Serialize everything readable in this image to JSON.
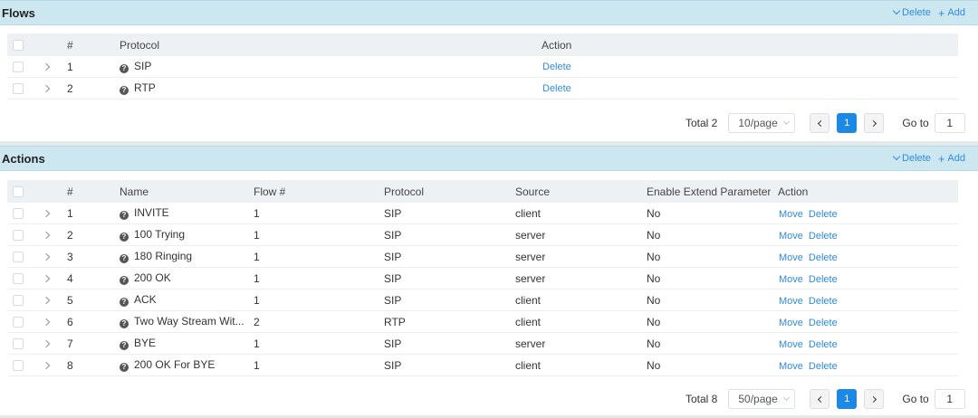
{
  "flows": {
    "title": "Flows",
    "delete_label": "Delete",
    "add_label": "Add",
    "columns": {
      "num": "#",
      "protocol": "Protocol",
      "action": "Action"
    },
    "rows": [
      {
        "num": "1",
        "protocol": "SIP",
        "action": "Delete"
      },
      {
        "num": "2",
        "protocol": "RTP",
        "action": "Delete"
      }
    ],
    "pager": {
      "total": "Total 2",
      "page_size": "10/page",
      "current_page": "1",
      "goto_label": "Go to",
      "goto_value": "1"
    }
  },
  "actions": {
    "title": "Actions",
    "delete_label": "Delete",
    "add_label": "Add",
    "columns": {
      "num": "#",
      "name": "Name",
      "flow": "Flow #",
      "protocol": "Protocol",
      "source": "Source",
      "extend": "Enable Extend Parameter",
      "action": "Action"
    },
    "rows": [
      {
        "num": "1",
        "name": "INVITE",
        "flow": "1",
        "protocol": "SIP",
        "source": "client",
        "extend": "No",
        "move": "Move",
        "delete": "Delete"
      },
      {
        "num": "2",
        "name": "100 Trying",
        "flow": "1",
        "protocol": "SIP",
        "source": "server",
        "extend": "No",
        "move": "Move",
        "delete": "Delete"
      },
      {
        "num": "3",
        "name": "180 Ringing",
        "flow": "1",
        "protocol": "SIP",
        "source": "server",
        "extend": "No",
        "move": "Move",
        "delete": "Delete"
      },
      {
        "num": "4",
        "name": "200 OK",
        "flow": "1",
        "protocol": "SIP",
        "source": "server",
        "extend": "No",
        "move": "Move",
        "delete": "Delete"
      },
      {
        "num": "5",
        "name": "ACK",
        "flow": "1",
        "protocol": "SIP",
        "source": "client",
        "extend": "No",
        "move": "Move",
        "delete": "Delete"
      },
      {
        "num": "6",
        "name": "Two Way Stream Wit...",
        "flow": "2",
        "protocol": "RTP",
        "source": "client",
        "extend": "No",
        "move": "Move",
        "delete": "Delete"
      },
      {
        "num": "7",
        "name": "BYE",
        "flow": "1",
        "protocol": "SIP",
        "source": "server",
        "extend": "No",
        "move": "Move",
        "delete": "Delete"
      },
      {
        "num": "8",
        "name": "200 OK For BYE",
        "flow": "1",
        "protocol": "SIP",
        "source": "client",
        "extend": "No",
        "move": "Move",
        "delete": "Delete"
      }
    ],
    "pager": {
      "total": "Total 8",
      "page_size": "50/page",
      "current_page": "1",
      "goto_label": "Go to",
      "goto_value": "1"
    }
  },
  "colors": {
    "header_bg": "#cde7f1",
    "link": "#2f8be0",
    "active_page": "#1e88e5"
  },
  "icons": {
    "row_icon": "question-circle-icon",
    "expand": "chevron-right-icon"
  }
}
